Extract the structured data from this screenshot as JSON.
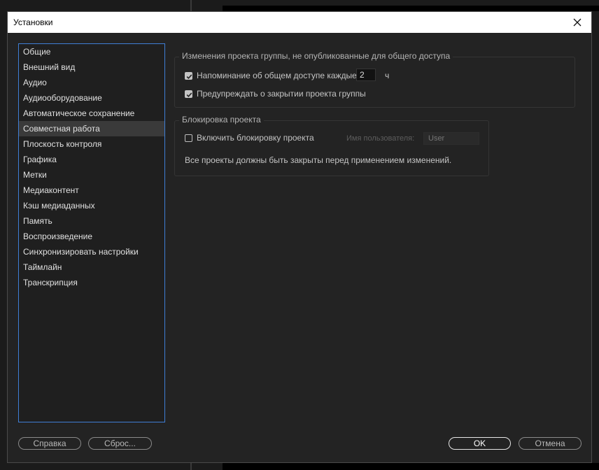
{
  "dialog": {
    "title": "Установки",
    "close_icon": "close-icon"
  },
  "sidebar": {
    "items": [
      {
        "label": "Общие"
      },
      {
        "label": "Внешний вид"
      },
      {
        "label": "Аудио"
      },
      {
        "label": "Аудиооборудование"
      },
      {
        "label": "Автоматическое сохранение"
      },
      {
        "label": "Совместная работа",
        "selected": true
      },
      {
        "label": "Плоскость контроля"
      },
      {
        "label": "Графика"
      },
      {
        "label": "Метки"
      },
      {
        "label": "Медиаконтент"
      },
      {
        "label": "Кэш медиаданных"
      },
      {
        "label": "Память"
      },
      {
        "label": "Воспроизведение"
      },
      {
        "label": "Синхронизировать настройки"
      },
      {
        "label": "Таймлайн"
      },
      {
        "label": "Транскрипция"
      }
    ]
  },
  "group_changes": {
    "title": "Изменения проекта группы, не опубликованные для общего доступа",
    "reminder_label": "Напоминание об общем доступе каждые:",
    "reminder_checked": true,
    "reminder_value": "2",
    "reminder_unit": "ч",
    "warn_label": "Предупреждать о закрытии проекта группы",
    "warn_checked": true
  },
  "group_lock": {
    "title": "Блокировка проекта",
    "enable_label": "Включить блокировку проекта",
    "enable_checked": false,
    "username_label": "Имя пользователя:",
    "username_placeholder": "User",
    "note": "Все проекты должны быть закрыты перед применением изменений."
  },
  "footer": {
    "help_label": "Справка",
    "reset_label": "Сброс...",
    "ok_label": "OK",
    "cancel_label": "Отмена"
  },
  "colors": {
    "accent": "#3f7fd6",
    "dialog_bg": "#232323",
    "titlebar_bg": "#ffffff"
  }
}
